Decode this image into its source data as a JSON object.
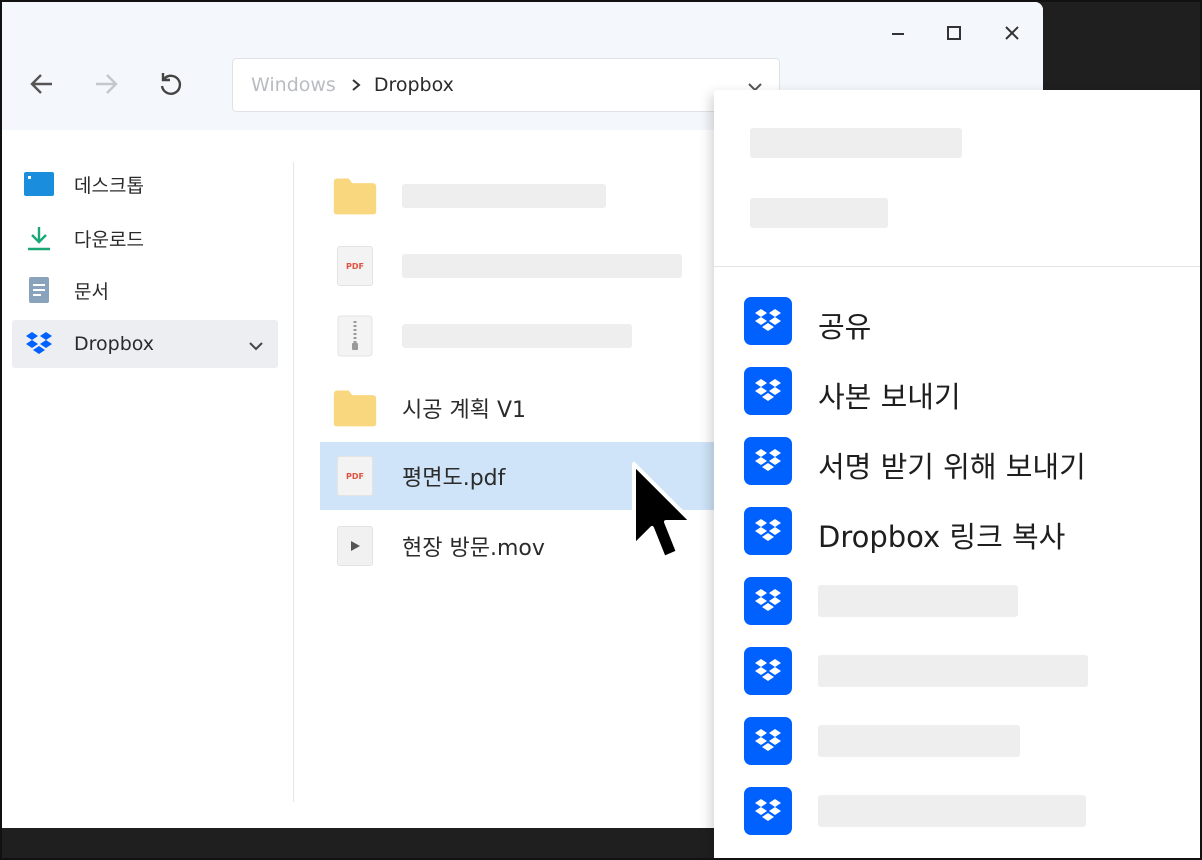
{
  "address_bar": {
    "root": "Windows",
    "current": "Dropbox"
  },
  "sidebar": {
    "items": [
      {
        "label": "데스크톱",
        "icon": "desktop-icon"
      },
      {
        "label": "다운로드",
        "icon": "download-icon"
      },
      {
        "label": "문서",
        "icon": "document-icon"
      },
      {
        "label": "Dropbox",
        "icon": "dropbox-icon",
        "selected": true
      }
    ]
  },
  "files": [
    {
      "name": "",
      "icon": "folder-icon",
      "placeholder": true
    },
    {
      "name": "",
      "icon": "pdf-file-icon",
      "placeholder": true
    },
    {
      "name": "",
      "icon": "zip-file-icon",
      "placeholder": true
    },
    {
      "name": "시공 계획 V1",
      "icon": "folder-icon"
    },
    {
      "name": "평면도.pdf",
      "icon": "pdf-file-icon",
      "selected": true
    },
    {
      "name": "현장 방문.mov",
      "icon": "video-file-icon"
    }
  ],
  "file_icon_text": {
    "pdf": "PDF"
  },
  "context_menu": {
    "items": [
      {
        "label": "공유",
        "icon": "dropbox-icon"
      },
      {
        "label": "사본 보내기",
        "icon": "dropbox-icon"
      },
      {
        "label": "서명 받기 위해 보내기",
        "icon": "dropbox-icon"
      },
      {
        "label": "Dropbox 링크 복사",
        "icon": "dropbox-icon"
      }
    ]
  },
  "colors": {
    "dropbox_blue": "#0061fe",
    "selection": "#cfe4f8",
    "folder": "#f9d77e"
  }
}
